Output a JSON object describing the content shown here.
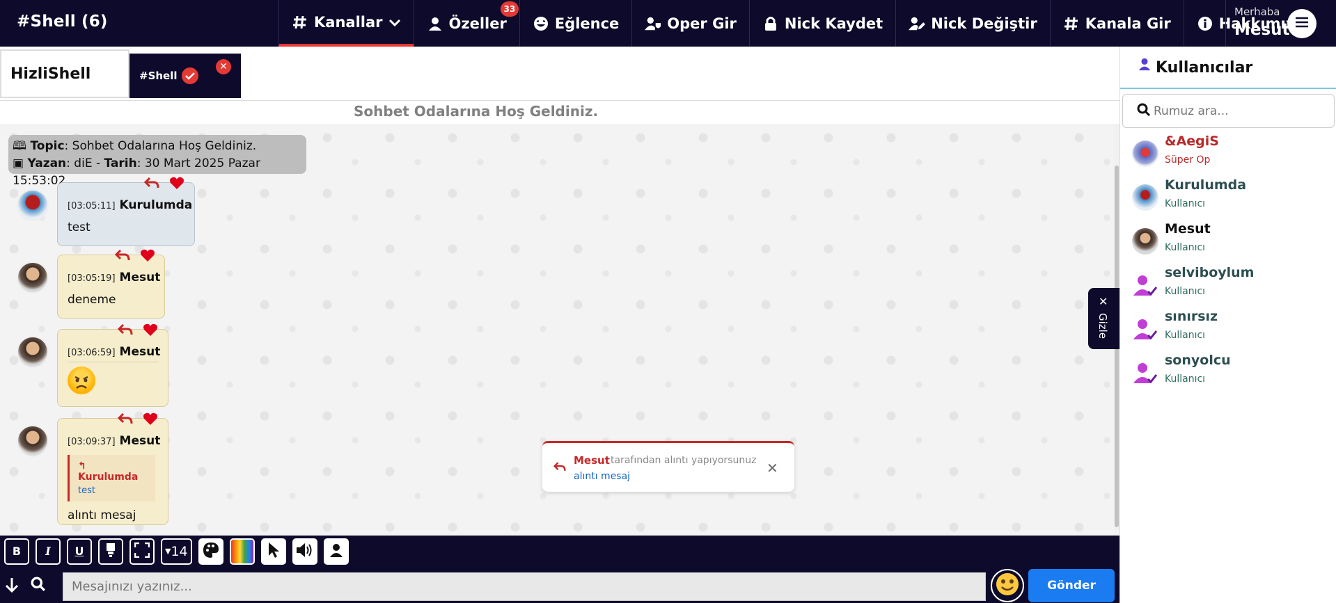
{
  "brand": "#Shell (6)",
  "nav": [
    {
      "label": "Kanallar",
      "icon": "hash-icon"
    },
    {
      "label": "Özeller",
      "icon": "user-icon",
      "badge": "33"
    },
    {
      "label": "Eğlence",
      "icon": "laugh-icon"
    },
    {
      "label": "Oper Gir",
      "icon": "user-shield-icon"
    },
    {
      "label": "Nick Kaydet",
      "icon": "lock-icon"
    },
    {
      "label": "Nick Değiştir",
      "icon": "user-edit-icon"
    },
    {
      "label": "Kanala Gir",
      "icon": "hash-icon"
    },
    {
      "label": "Hakkımızda",
      "icon": "info-icon"
    }
  ],
  "greeting": {
    "hello": "Merhaba",
    "name": "Mesut"
  },
  "tabs": {
    "home": "HizliShell",
    "channel": "#Shell"
  },
  "welcome": "Sohbet Odalarına Hoş Geldiniz.",
  "topic": {
    "topic_label": "Topic",
    "topic_text": ": Sohbet Odalarına Hoş Geldiniz.",
    "author_label": "Yazan",
    "author": ": diE - ",
    "date_label": "Tarih",
    "date": ": 30 Mart 2025 Pazar 15:53:02"
  },
  "messages": [
    {
      "time": "[03:05:11]",
      "nick": "Kurulumda",
      "text": "test"
    },
    {
      "time": "[03:05:19]",
      "nick": "Mesut",
      "text": "deneme"
    },
    {
      "time": "[03:06:59]",
      "nick": "Mesut",
      "text": ""
    },
    {
      "time": "[03:09:37]",
      "nick": "Mesut",
      "quote_nick": "Kurulumda",
      "quote_text": "test",
      "text": "alıntı mesaj"
    }
  ],
  "notice": {
    "nick": "Mesut",
    "text": "tarafından alıntı yapıyorsunuz",
    "quote": "alıntı mesaj"
  },
  "hide_label": "Gizle",
  "users_panel": {
    "title": "Kullanıcılar",
    "search_placeholder": "Rumuz ara...",
    "users": [
      {
        "name": "&AegiS",
        "role": "Süper Op"
      },
      {
        "name": "Kurulumda",
        "role": "Kullanıcı"
      },
      {
        "name": "Mesut",
        "role": "Kullanıcı"
      },
      {
        "name": "selviboylum",
        "role": "Kullanıcı"
      },
      {
        "name": "sınırsız",
        "role": "Kullanıcı"
      },
      {
        "name": "sonyolcu",
        "role": "Kullanıcı"
      }
    ]
  },
  "toolbar": {
    "bold": "B",
    "italic": "I",
    "underline": "U",
    "font_size": "14"
  },
  "input": {
    "placeholder": "Mesajınızı yazınız...",
    "send": "Gönder"
  },
  "colors": {
    "nav_bg": "#0d0a2b",
    "accent_red": "#e53935",
    "send_blue": "#1a7cf0"
  }
}
